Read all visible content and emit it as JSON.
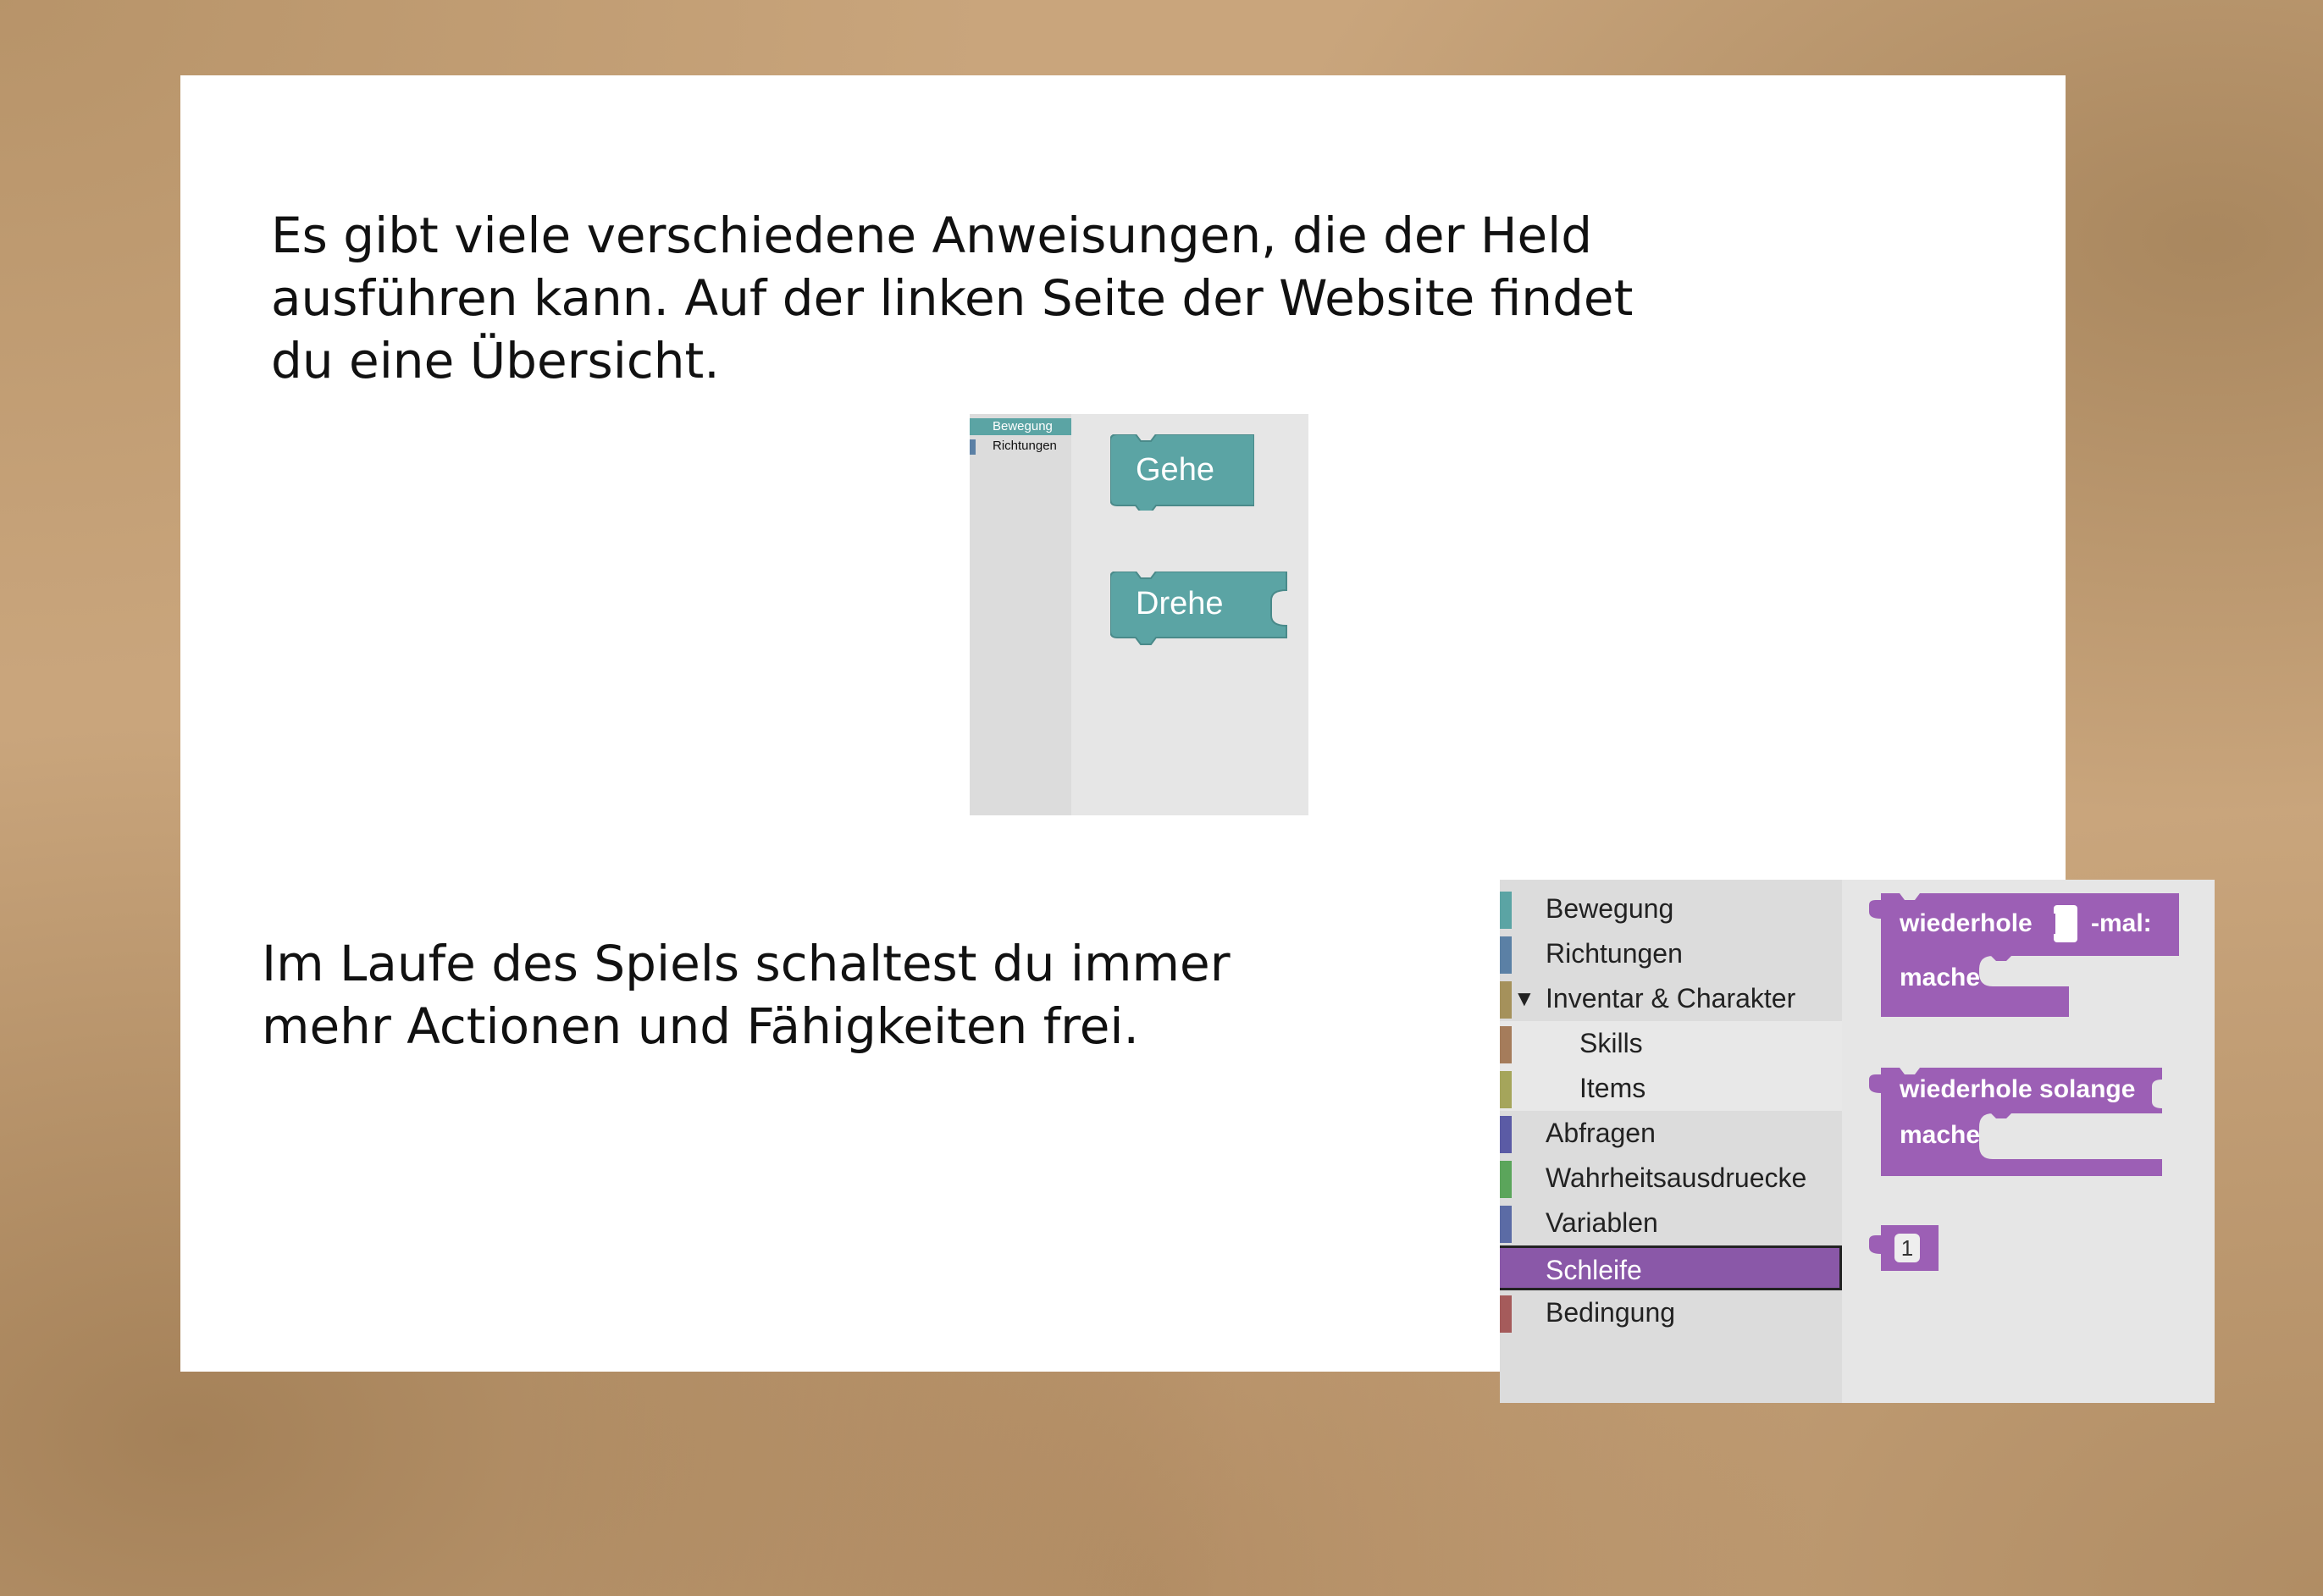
{
  "slide": {
    "paragraph_1": "Es gibt viele verschiedene Anweisungen, die der Held ausführen kann. Auf der linken Seite der Website findet du eine Übersicht.",
    "paragraph_1_lines": [
      "Es gibt viele verschiedene Anweisungen, die der Held",
      "ausführen kann. Auf der linken Seite der Website findet",
      "du eine Übersicht."
    ],
    "paragraph_2_lines": [
      "Im Laufe des Spiels schaltest du immer",
      "mehr Actionen und Fähigkeiten frei."
    ]
  },
  "toolbox_small": {
    "categories": [
      {
        "label": "Bewegung",
        "color": "#5ba4a4",
        "selected": true
      },
      {
        "label": "Richtungen",
        "color": "#5b80a5",
        "selected": false
      }
    ],
    "blocks": [
      {
        "label": "Gehe",
        "color": "#5ba4a4"
      },
      {
        "label": "Drehe",
        "color": "#5ba4a4"
      }
    ]
  },
  "toolbox_large": {
    "categories": [
      {
        "label": "Bewegung",
        "color": "#5ba4a4"
      },
      {
        "label": "Richtungen",
        "color": "#5b80a5"
      },
      {
        "label": "Inventar & Charakter",
        "color": "#a5915b",
        "expanded": true,
        "arrow": "▼"
      },
      {
        "label": "Skills",
        "color": "#a57c5b",
        "sub": true
      },
      {
        "label": "Items",
        "color": "#a5a55b",
        "sub": true
      },
      {
        "label": "Abfragen",
        "color": "#5b5ba5"
      },
      {
        "label": "Wahrheitsausdruecke",
        "color": "#5ba55b"
      },
      {
        "label": "Variablen",
        "color": "#5b6ba5"
      },
      {
        "label": "Schleife",
        "color": "#8a58a8",
        "selected": true
      },
      {
        "label": "Bedingung",
        "color": "#a55b5b"
      }
    ],
    "blocks": {
      "repeat_times": {
        "label": "wiederhole",
        "suffix": "-mal:",
        "do_label": "mache"
      },
      "repeat_while": {
        "label": "wiederhole solange",
        "do_label": "mache"
      },
      "number": {
        "value": "1"
      }
    },
    "block_color": "#9c5fb5"
  }
}
